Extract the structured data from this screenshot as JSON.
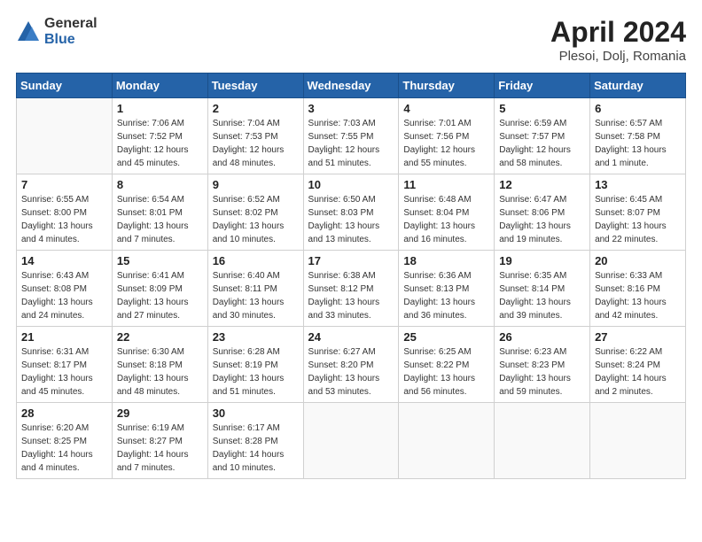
{
  "logo": {
    "general": "General",
    "blue": "Blue"
  },
  "title": "April 2024",
  "subtitle": "Plesoi, Dolj, Romania",
  "weekdays": [
    "Sunday",
    "Monday",
    "Tuesday",
    "Wednesday",
    "Thursday",
    "Friday",
    "Saturday"
  ],
  "weeks": [
    [
      {
        "day": "",
        "info": ""
      },
      {
        "day": "1",
        "info": "Sunrise: 7:06 AM\nSunset: 7:52 PM\nDaylight: 12 hours\nand 45 minutes."
      },
      {
        "day": "2",
        "info": "Sunrise: 7:04 AM\nSunset: 7:53 PM\nDaylight: 12 hours\nand 48 minutes."
      },
      {
        "day": "3",
        "info": "Sunrise: 7:03 AM\nSunset: 7:55 PM\nDaylight: 12 hours\nand 51 minutes."
      },
      {
        "day": "4",
        "info": "Sunrise: 7:01 AM\nSunset: 7:56 PM\nDaylight: 12 hours\nand 55 minutes."
      },
      {
        "day": "5",
        "info": "Sunrise: 6:59 AM\nSunset: 7:57 PM\nDaylight: 12 hours\nand 58 minutes."
      },
      {
        "day": "6",
        "info": "Sunrise: 6:57 AM\nSunset: 7:58 PM\nDaylight: 13 hours\nand 1 minute."
      }
    ],
    [
      {
        "day": "7",
        "info": "Sunrise: 6:55 AM\nSunset: 8:00 PM\nDaylight: 13 hours\nand 4 minutes."
      },
      {
        "day": "8",
        "info": "Sunrise: 6:54 AM\nSunset: 8:01 PM\nDaylight: 13 hours\nand 7 minutes."
      },
      {
        "day": "9",
        "info": "Sunrise: 6:52 AM\nSunset: 8:02 PM\nDaylight: 13 hours\nand 10 minutes."
      },
      {
        "day": "10",
        "info": "Sunrise: 6:50 AM\nSunset: 8:03 PM\nDaylight: 13 hours\nand 13 minutes."
      },
      {
        "day": "11",
        "info": "Sunrise: 6:48 AM\nSunset: 8:04 PM\nDaylight: 13 hours\nand 16 minutes."
      },
      {
        "day": "12",
        "info": "Sunrise: 6:47 AM\nSunset: 8:06 PM\nDaylight: 13 hours\nand 19 minutes."
      },
      {
        "day": "13",
        "info": "Sunrise: 6:45 AM\nSunset: 8:07 PM\nDaylight: 13 hours\nand 22 minutes."
      }
    ],
    [
      {
        "day": "14",
        "info": "Sunrise: 6:43 AM\nSunset: 8:08 PM\nDaylight: 13 hours\nand 24 minutes."
      },
      {
        "day": "15",
        "info": "Sunrise: 6:41 AM\nSunset: 8:09 PM\nDaylight: 13 hours\nand 27 minutes."
      },
      {
        "day": "16",
        "info": "Sunrise: 6:40 AM\nSunset: 8:11 PM\nDaylight: 13 hours\nand 30 minutes."
      },
      {
        "day": "17",
        "info": "Sunrise: 6:38 AM\nSunset: 8:12 PM\nDaylight: 13 hours\nand 33 minutes."
      },
      {
        "day": "18",
        "info": "Sunrise: 6:36 AM\nSunset: 8:13 PM\nDaylight: 13 hours\nand 36 minutes."
      },
      {
        "day": "19",
        "info": "Sunrise: 6:35 AM\nSunset: 8:14 PM\nDaylight: 13 hours\nand 39 minutes."
      },
      {
        "day": "20",
        "info": "Sunrise: 6:33 AM\nSunset: 8:16 PM\nDaylight: 13 hours\nand 42 minutes."
      }
    ],
    [
      {
        "day": "21",
        "info": "Sunrise: 6:31 AM\nSunset: 8:17 PM\nDaylight: 13 hours\nand 45 minutes."
      },
      {
        "day": "22",
        "info": "Sunrise: 6:30 AM\nSunset: 8:18 PM\nDaylight: 13 hours\nand 48 minutes."
      },
      {
        "day": "23",
        "info": "Sunrise: 6:28 AM\nSunset: 8:19 PM\nDaylight: 13 hours\nand 51 minutes."
      },
      {
        "day": "24",
        "info": "Sunrise: 6:27 AM\nSunset: 8:20 PM\nDaylight: 13 hours\nand 53 minutes."
      },
      {
        "day": "25",
        "info": "Sunrise: 6:25 AM\nSunset: 8:22 PM\nDaylight: 13 hours\nand 56 minutes."
      },
      {
        "day": "26",
        "info": "Sunrise: 6:23 AM\nSunset: 8:23 PM\nDaylight: 13 hours\nand 59 minutes."
      },
      {
        "day": "27",
        "info": "Sunrise: 6:22 AM\nSunset: 8:24 PM\nDaylight: 14 hours\nand 2 minutes."
      }
    ],
    [
      {
        "day": "28",
        "info": "Sunrise: 6:20 AM\nSunset: 8:25 PM\nDaylight: 14 hours\nand 4 minutes."
      },
      {
        "day": "29",
        "info": "Sunrise: 6:19 AM\nSunset: 8:27 PM\nDaylight: 14 hours\nand 7 minutes."
      },
      {
        "day": "30",
        "info": "Sunrise: 6:17 AM\nSunset: 8:28 PM\nDaylight: 14 hours\nand 10 minutes."
      },
      {
        "day": "",
        "info": ""
      },
      {
        "day": "",
        "info": ""
      },
      {
        "day": "",
        "info": ""
      },
      {
        "day": "",
        "info": ""
      }
    ]
  ]
}
